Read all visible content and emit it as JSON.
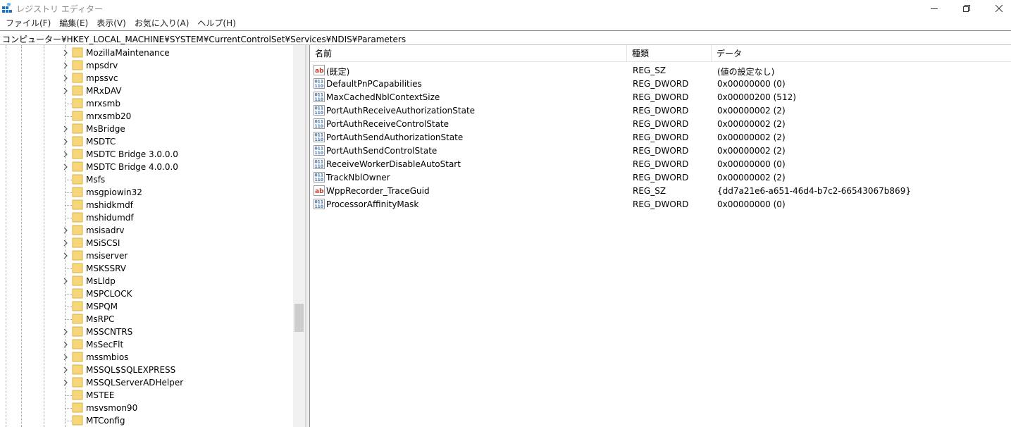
{
  "window": {
    "title": "レジストリ エディター",
    "minimize_icon": "minimize-icon",
    "maximize_icon": "restore-icon",
    "close_icon": "close-icon"
  },
  "menu": {
    "items": [
      "ファイル(F)",
      "編集(E)",
      "表示(V)",
      "お気に入り(A)",
      "ヘルプ(H)"
    ]
  },
  "address": {
    "path": "コンピューター¥HKEY_LOCAL_MACHINE¥SYSTEM¥CurrentControlSet¥Services¥NDIS¥Parameters"
  },
  "tree": {
    "items": [
      {
        "label": "MozillaMaintenance",
        "expandable": true
      },
      {
        "label": "mpsdrv",
        "expandable": true
      },
      {
        "label": "mpssvc",
        "expandable": true
      },
      {
        "label": "MRxDAV",
        "expandable": true
      },
      {
        "label": "mrxsmb",
        "expandable": false
      },
      {
        "label": "mrxsmb20",
        "expandable": false
      },
      {
        "label": "MsBridge",
        "expandable": true
      },
      {
        "label": "MSDTC",
        "expandable": true
      },
      {
        "label": "MSDTC Bridge 3.0.0.0",
        "expandable": true
      },
      {
        "label": "MSDTC Bridge 4.0.0.0",
        "expandable": true
      },
      {
        "label": "Msfs",
        "expandable": false
      },
      {
        "label": "msgpiowin32",
        "expandable": false
      },
      {
        "label": "mshidkmdf",
        "expandable": false
      },
      {
        "label": "mshidumdf",
        "expandable": false
      },
      {
        "label": "msisadrv",
        "expandable": true
      },
      {
        "label": "MSiSCSI",
        "expandable": true
      },
      {
        "label": "msiserver",
        "expandable": true
      },
      {
        "label": "MSKSSRV",
        "expandable": false
      },
      {
        "label": "MsLldp",
        "expandable": true
      },
      {
        "label": "MSPCLOCK",
        "expandable": false
      },
      {
        "label": "MSPQM",
        "expandable": false
      },
      {
        "label": "MsRPC",
        "expandable": false
      },
      {
        "label": "MSSCNTRS",
        "expandable": true
      },
      {
        "label": "MsSecFlt",
        "expandable": true
      },
      {
        "label": "mssmbios",
        "expandable": true
      },
      {
        "label": "MSSQL$SQLEXPRESS",
        "expandable": true
      },
      {
        "label": "MSSQLServerADHelper",
        "expandable": true
      },
      {
        "label": "MSTEE",
        "expandable": false
      },
      {
        "label": "msvsmon90",
        "expandable": false
      },
      {
        "label": "MTConfig",
        "expandable": false
      }
    ]
  },
  "list": {
    "columns": {
      "name": "名前",
      "type": "種類",
      "data": "データ"
    },
    "rows": [
      {
        "icon": "string-value-icon",
        "name": "(既定)",
        "type": "REG_SZ",
        "data": "(値の設定なし)"
      },
      {
        "icon": "binary-value-icon",
        "name": "DefaultPnPCapabilities",
        "type": "REG_DWORD",
        "data": "0x00000000 (0)"
      },
      {
        "icon": "binary-value-icon",
        "name": "MaxCachedNblContextSize",
        "type": "REG_DWORD",
        "data": "0x00000200 (512)"
      },
      {
        "icon": "binary-value-icon",
        "name": "PortAuthReceiveAuthorizationState",
        "type": "REG_DWORD",
        "data": "0x00000002 (2)"
      },
      {
        "icon": "binary-value-icon",
        "name": "PortAuthReceiveControlState",
        "type": "REG_DWORD",
        "data": "0x00000002 (2)"
      },
      {
        "icon": "binary-value-icon",
        "name": "PortAuthSendAuthorizationState",
        "type": "REG_DWORD",
        "data": "0x00000002 (2)"
      },
      {
        "icon": "binary-value-icon",
        "name": "PortAuthSendControlState",
        "type": "REG_DWORD",
        "data": "0x00000002 (2)"
      },
      {
        "icon": "binary-value-icon",
        "name": "ReceiveWorkerDisableAutoStart",
        "type": "REG_DWORD",
        "data": "0x00000000 (0)"
      },
      {
        "icon": "binary-value-icon",
        "name": "TrackNblOwner",
        "type": "REG_DWORD",
        "data": "0x00000002 (2)"
      },
      {
        "icon": "string-value-icon",
        "name": "WppRecorder_TraceGuid",
        "type": "REG_SZ",
        "data": "{dd7a21e6-a651-46d4-b7c2-66543067b869}"
      },
      {
        "icon": "binary-value-icon",
        "name": "ProcessorAffinityMask",
        "type": "REG_DWORD",
        "data": "0x00000000 (0)"
      }
    ]
  },
  "colors": {
    "folder": "#f5d77a",
    "folder_border": "#d8b04a",
    "binary_icon": "#3a6ea5",
    "string_icon": "#c0392b"
  }
}
